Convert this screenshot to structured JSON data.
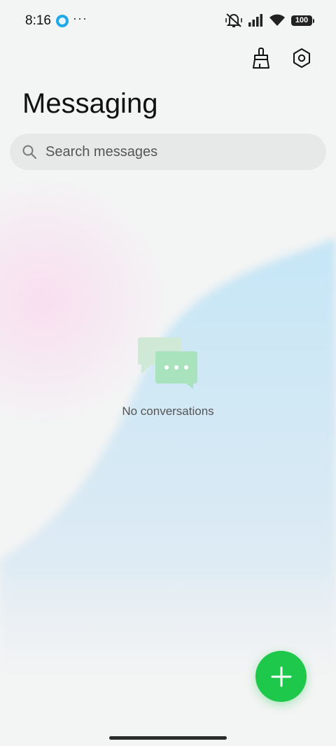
{
  "status_bar": {
    "time": "8:16",
    "more": "···",
    "battery": "100"
  },
  "header": {
    "title": "Messaging",
    "actions": [
      {
        "name": "clean-icon"
      },
      {
        "name": "settings-icon"
      }
    ]
  },
  "search": {
    "placeholder": "Search messages",
    "value": ""
  },
  "empty_state": {
    "text": "No conversations"
  },
  "fab": {
    "icon": "plus-icon",
    "color": "#1ec84a"
  }
}
